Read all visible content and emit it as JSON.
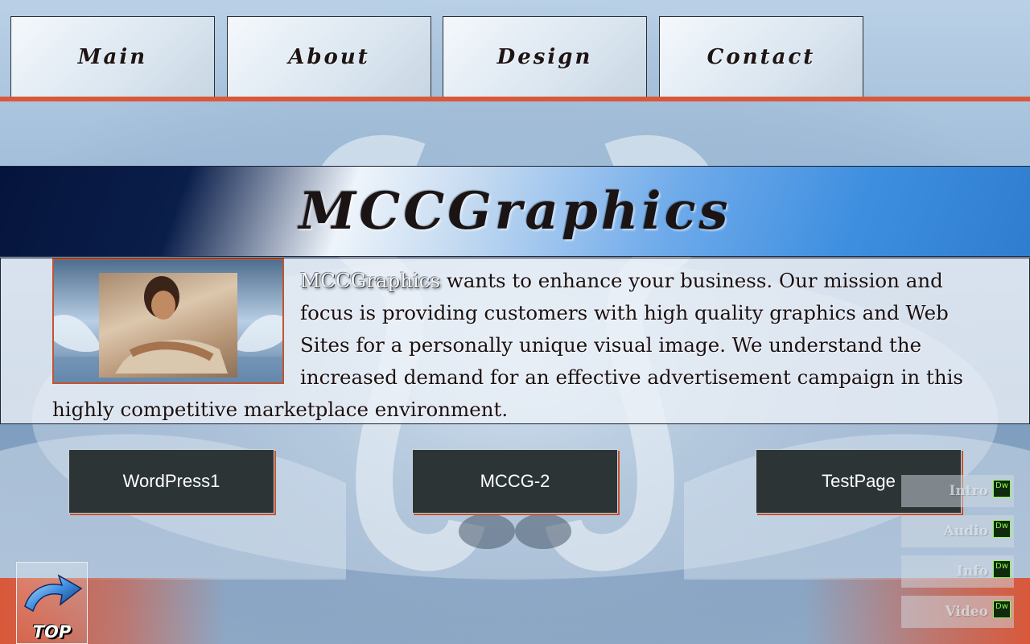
{
  "nav": {
    "tabs": [
      {
        "label": "Main"
      },
      {
        "label": "About"
      },
      {
        "label": "Design"
      },
      {
        "label": "Contact"
      }
    ]
  },
  "banner": {
    "title": "MCCGraphics"
  },
  "content": {
    "brand_word": "MCCGraphics",
    "paragraph": " wants to enhance your business. Our mission and focus is providing customers with high quality graphics and Web Sites for a personally unique visual image. We understand the increased demand for an effective advertisement campaign in this highly competitive marketplace environment."
  },
  "buttons": [
    {
      "label": "WordPress1"
    },
    {
      "label": "MCCG-2"
    },
    {
      "label": "TestPage"
    }
  ],
  "top_button": {
    "label": "TOP"
  },
  "side_menu": [
    {
      "label": "Intro",
      "badge": "Dw"
    },
    {
      "label": "Audio",
      "badge": "Dw"
    },
    {
      "label": "Info",
      "badge": "Dw"
    },
    {
      "label": "Video",
      "badge": "Dw"
    }
  ],
  "colors": {
    "accent": "#d9583a",
    "button_bg": "#2c3436",
    "banner_dark": "#05143c",
    "banner_blue": "#3f8fe0"
  }
}
